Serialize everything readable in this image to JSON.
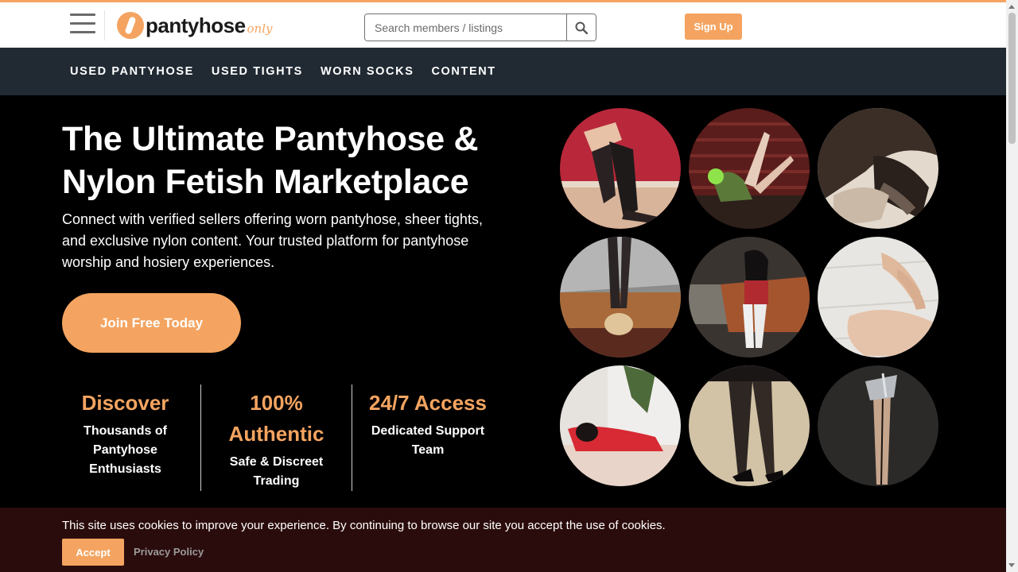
{
  "brand": {
    "name": "pantyhose",
    "accent": "only",
    "accent_color": "#f4a460",
    "nav_bg": "#212a33",
    "cookie_bg": "#2b0c0c"
  },
  "header": {
    "search_placeholder": "Search members / listings",
    "signup_label": "Sign Up"
  },
  "nav": {
    "items": [
      {
        "label": "USED PANTYHOSE"
      },
      {
        "label": "USED TIGHTS"
      },
      {
        "label": "WORN SOCKS"
      },
      {
        "label": "CONTENT"
      }
    ]
  },
  "hero": {
    "title": "The Ultimate Pantyhose & Nylon Fetish Marketplace",
    "subtitle": "Connect with verified sellers offering worn pantyhose, sheer tights, and exclusive nylon content. Your trusted platform for pantyhose worship and hosiery experiences.",
    "cta_label": "Join Free Today"
  },
  "stats": [
    {
      "value": "Discover",
      "label": "Thousands of Pantyhose Enthusiasts"
    },
    {
      "value": "100% Authentic",
      "label": "Safe & Discreet Trading"
    },
    {
      "value": "24/7 Access",
      "label": "Dedicated Support Team"
    }
  ],
  "cookie": {
    "text": "This site uses cookies to improve your experience. By continuing to browse our site you accept the use of cookies.",
    "accept_label": "Accept",
    "privacy_label": "Privacy Policy"
  }
}
